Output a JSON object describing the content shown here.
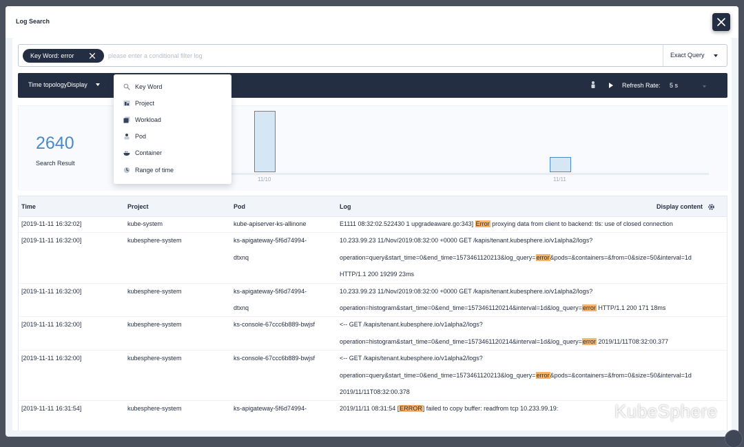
{
  "modal": {
    "title": "Log Search"
  },
  "search": {
    "chip_label": "Key Word: error",
    "placeholder": "please enter a conditional filter log",
    "value": "",
    "query_mode": "Exact Query"
  },
  "toolbar": {
    "topology_label": "Time topologyDisplay",
    "refresh_label": "Refresh Rate:",
    "refresh_value": "5 s"
  },
  "dropdown": {
    "items": [
      {
        "label": "Key Word",
        "icon": "search-icon"
      },
      {
        "label": "Project",
        "icon": "project-icon"
      },
      {
        "label": "Workload",
        "icon": "workload-icon"
      },
      {
        "label": "Pod",
        "icon": "pod-icon"
      },
      {
        "label": "Container",
        "icon": "container-icon"
      },
      {
        "label": "Range of time",
        "icon": "clock-icon"
      }
    ]
  },
  "stats": {
    "count": "2640",
    "label": "Search Result"
  },
  "chart_data": {
    "type": "bar",
    "categories": [
      "11/10",
      "11/11"
    ],
    "values": [
      100,
      25
    ],
    "ylim": [
      0,
      100
    ],
    "grid": false,
    "title": "",
    "xlabel": "",
    "ylabel": ""
  },
  "table": {
    "headers": [
      "Time",
      "Project",
      "Pod",
      "Log"
    ],
    "display_content": "Display content",
    "rows": [
      {
        "time": "[2019-11-11 16:32:02]",
        "project": "kube-system",
        "pod": [
          "kube-apiserver-ks-allinone"
        ],
        "log": [
          [
            "E1111 08:32:02.522430 1 upgradeaware.go:343] ",
            "Error",
            " proxying data from client to backend: tls: use of closed connection"
          ]
        ]
      },
      {
        "time": "[2019-11-11 16:32:00]",
        "project": "kubesphere-system",
        "pod": [
          "ks-apigateway-5f6d74994-",
          "dtxnq"
        ],
        "log": [
          [
            "10.233.99.23 11/Nov/2019:08:32:00 +0000 GET /kapis/tenant.kubesphere.io/v1alpha2/logs?"
          ],
          [
            "operation=query&start_time=0&end_time=1573461120213&log_query=",
            "error",
            "&pods=&containers=&from=0&size=50&interval=1d"
          ],
          [
            "HTTP/1.1 200 19299 23ms"
          ]
        ]
      },
      {
        "time": "[2019-11-11 16:32:00]",
        "project": "kubesphere-system",
        "pod": [
          "ks-apigateway-5f6d74994-",
          "dtxnq"
        ],
        "log": [
          [
            "10.233.99.23 11/Nov/2019:08:32:00 +0000 GET /kapis/tenant.kubesphere.io/v1alpha2/logs?"
          ],
          [
            "operation=histogram&start_time=0&end_time=1573461120214&interval=1d&log_query=",
            "error",
            " HTTP/1.1 200 171 18ms"
          ]
        ]
      },
      {
        "time": "[2019-11-11 16:32:00]",
        "project": "kubesphere-system",
        "pod": [
          "ks-console-67ccc6b889-bwjsf"
        ],
        "log": [
          [
            "<-- GET /kapis/tenant.kubesphere.io/v1alpha2/logs?"
          ],
          [
            "operation=histogram&start_time=0&end_time=1573461120214&interval=1d&log_query=",
            "error",
            " 2019/11/11T08:32:00.377"
          ]
        ]
      },
      {
        "time": "[2019-11-11 16:32:00]",
        "project": "kubesphere-system",
        "pod": [
          "ks-console-67ccc6b889-bwjsf"
        ],
        "log": [
          [
            "<-- GET /kapis/tenant.kubesphere.io/v1alpha2/logs?"
          ],
          [
            "operation=query&start_time=0&end_time=1573461120213&log_query=",
            "error",
            "&pods=&containers=&from=0&size=50&interval=1d"
          ],
          [
            "2019/11/11T08:32:00.378"
          ]
        ]
      },
      {
        "time": "[2019-11-11 16:31:54]",
        "project": "kubesphere-system",
        "pod": [
          "ks-apigateway-5f6d74994-"
        ],
        "log": [
          [
            "2019/11/11 08:31:54 [",
            "ERROR",
            "] failed to copy buffer: readfrom tcp 10.233.99.19:"
          ]
        ]
      }
    ]
  },
  "watermark": "KubeSphere"
}
